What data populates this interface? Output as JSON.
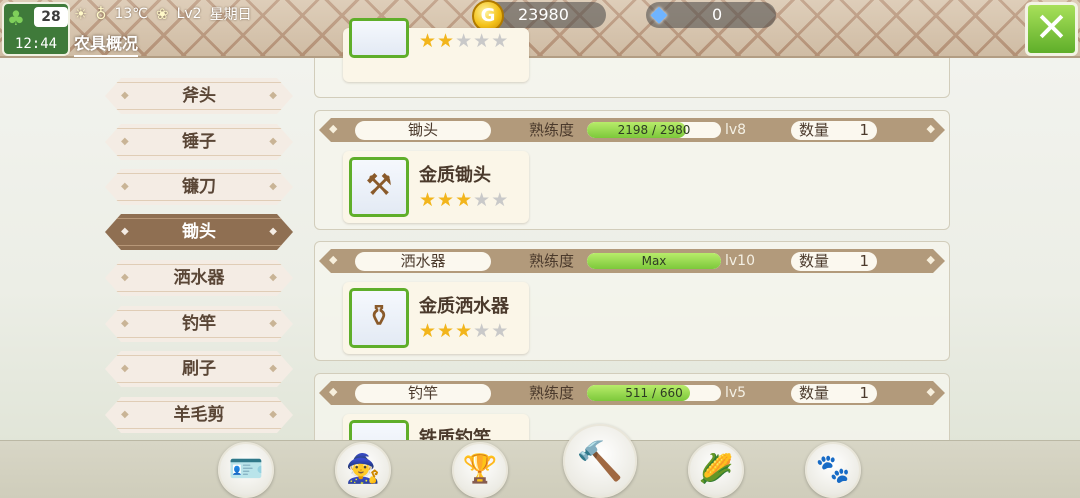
{
  "player": {
    "level": "28",
    "time": "12:44"
  },
  "status": {
    "temperature": "13℃",
    "season_level": "Lv2",
    "weekday": "星期日"
  },
  "page_title": "农具概况",
  "currency": {
    "gold": "23980",
    "gems": "0"
  },
  "categories": [
    {
      "label": "斧头",
      "active": false
    },
    {
      "label": "锤子",
      "active": false
    },
    {
      "label": "镰刀",
      "active": false
    },
    {
      "label": "锄头",
      "active": true
    },
    {
      "label": "洒水器",
      "active": false
    },
    {
      "label": "钓竿",
      "active": false
    },
    {
      "label": "刷子",
      "active": false
    },
    {
      "label": "羊毛剪",
      "active": false
    }
  ],
  "proficiency_label": "熟练度",
  "quantity_label": "数量",
  "tools": [
    {
      "category": "锄头",
      "proficiency_text": "2198 / 2980",
      "proficiency_ratio": 0.74,
      "level": "lv8",
      "quantity": "1",
      "item": {
        "name": "金质锄头",
        "icon": "hoe-icon",
        "stars": 3
      }
    },
    {
      "category": "洒水器",
      "proficiency_text": "Max",
      "proficiency_ratio": 1.0,
      "level": "lv10",
      "quantity": "1",
      "item": {
        "name": "金质洒水器",
        "icon": "watering-can-icon",
        "stars": 3
      }
    },
    {
      "category": "钓竿",
      "proficiency_text": "511 / 660",
      "proficiency_ratio": 0.77,
      "level": "lv5",
      "quantity": "1",
      "item": {
        "name": "铁质钓竿",
        "icon": "fishing-rod-icon",
        "stars": 0
      }
    }
  ],
  "previous_item_stars": 2,
  "colors": {
    "accent_green": "#7cc83a",
    "tab_active": "#8f6f52",
    "header_bar": "#b29a7b",
    "star": "#f2b51c"
  },
  "bottom_nav_icons": [
    "id-card-icon",
    "wizard-hat-icon",
    "trophy-icon",
    "hammer-icon",
    "corn-icon",
    "paw-icon"
  ]
}
